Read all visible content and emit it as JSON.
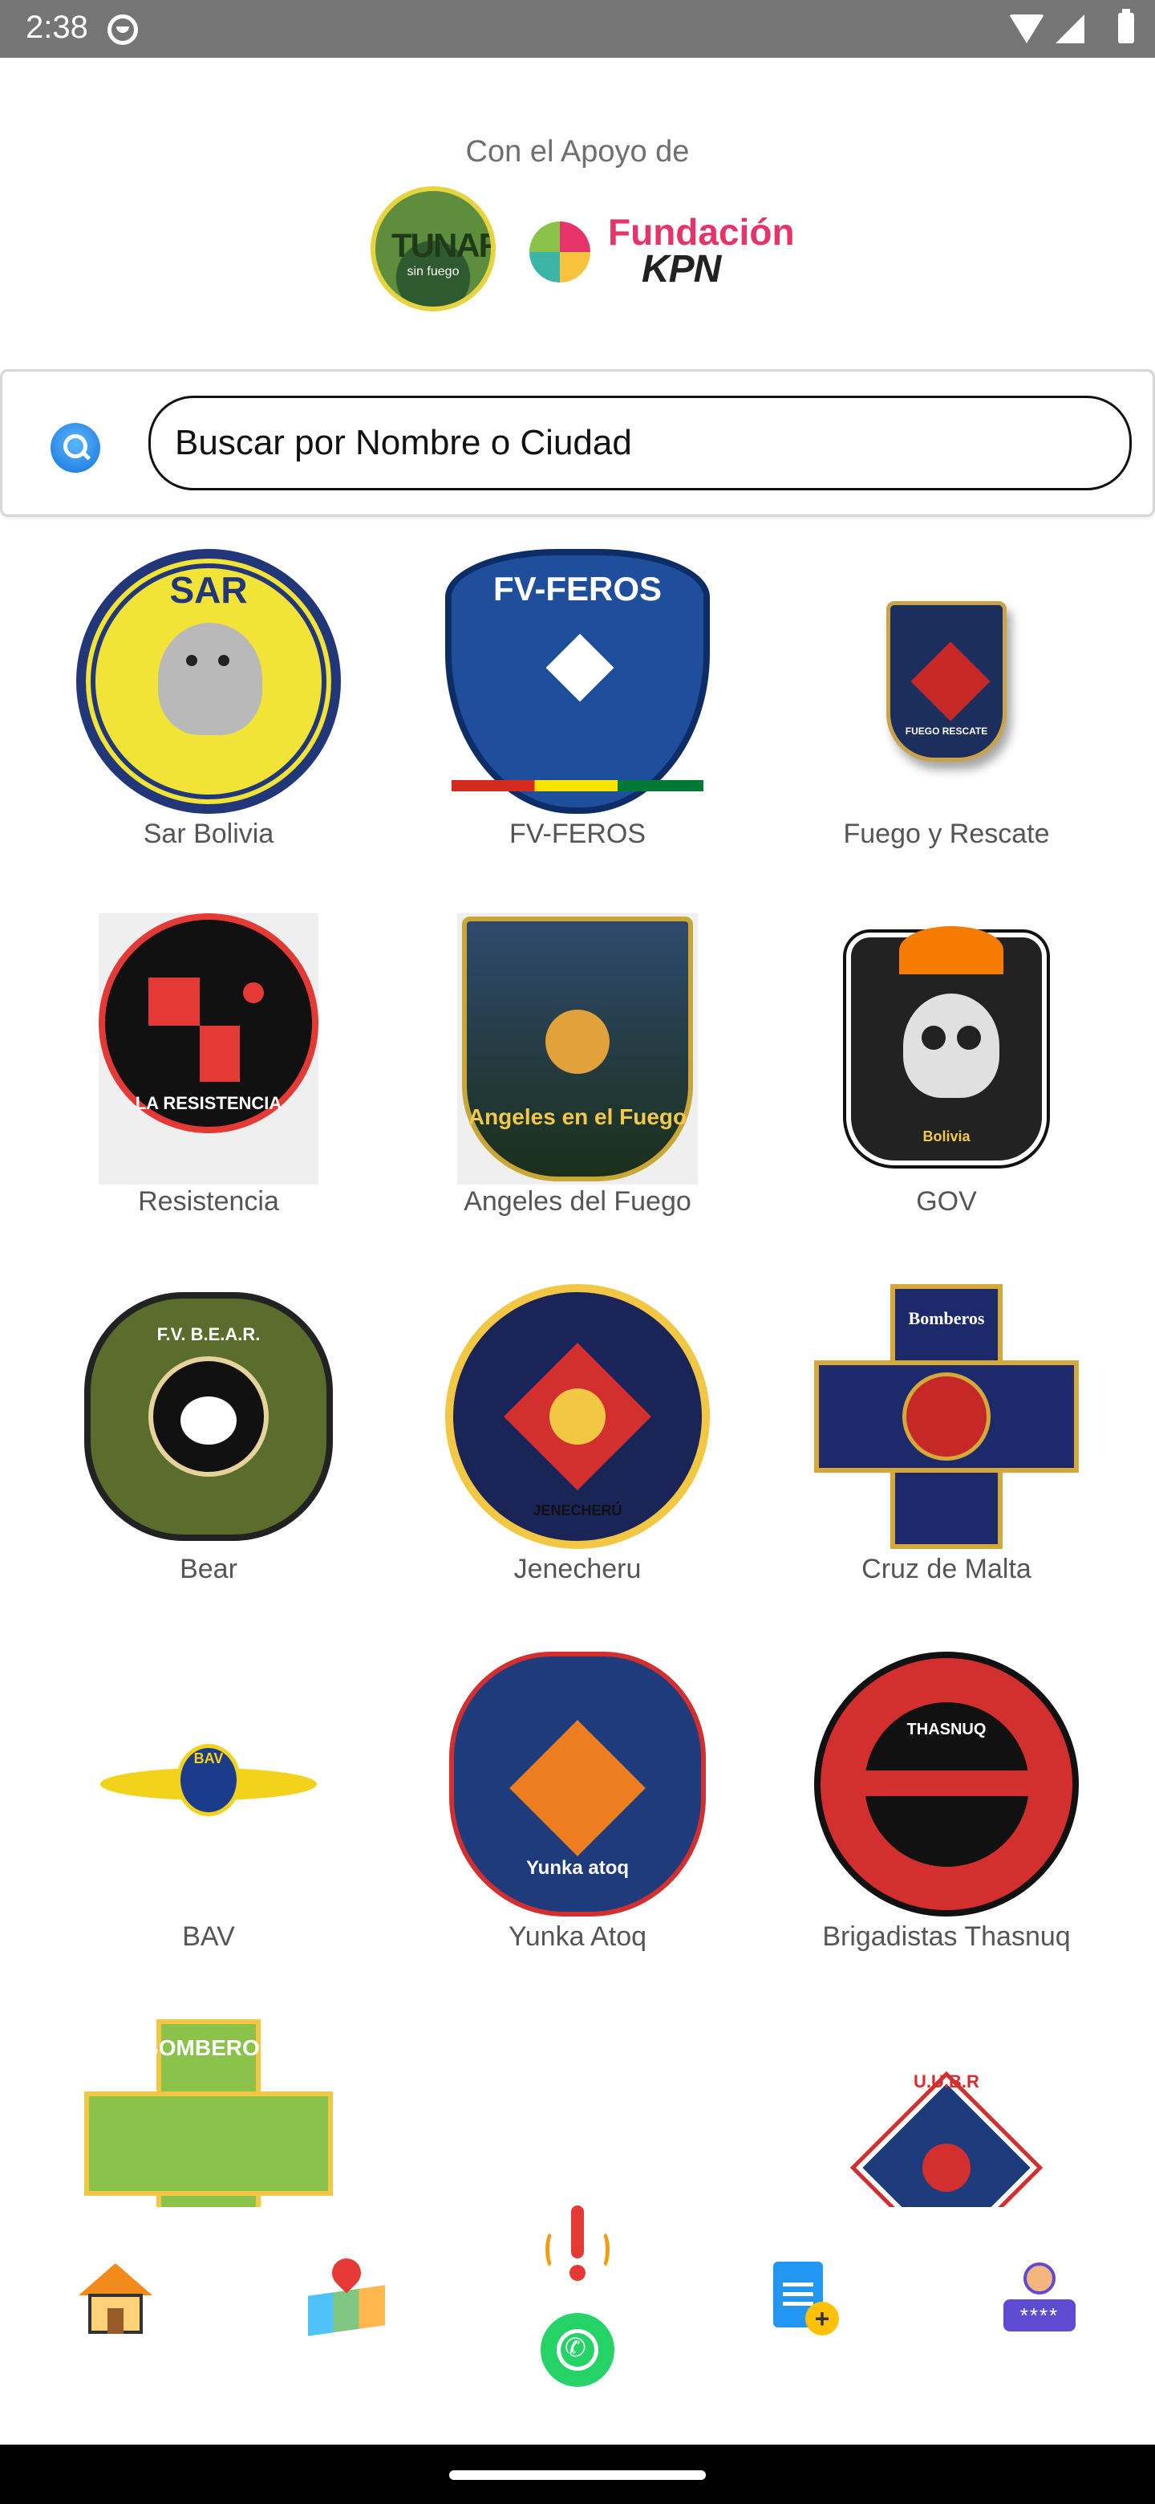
{
  "status_bar": {
    "time": "2:38"
  },
  "header": {
    "sponsor_caption": "Con el Apoyo de",
    "tunari_text": "TUNARI",
    "tunari_sub": "sin fuego",
    "kpn_line1": "Fundación",
    "kpn_line2": "KPN"
  },
  "search": {
    "placeholder": "Buscar por Nombre o Ciudad",
    "value": ""
  },
  "groups": [
    {
      "name": "Sar Bolivia",
      "badge": "SAR"
    },
    {
      "name": "FV-FEROS",
      "badge": "FV-FEROS"
    },
    {
      "name": "Fuego y Rescate",
      "badge": "FUEGO RESCATE"
    },
    {
      "name": "Resistencia",
      "badge": "LA RESISTENCIA"
    },
    {
      "name": "Angeles del Fuego",
      "badge": "Angeles en el Fuego"
    },
    {
      "name": "GOV",
      "badge": "Bolivia"
    },
    {
      "name": "Bear",
      "badge": "F.V. B.E.A.R."
    },
    {
      "name": "Jenecheru",
      "badge": "JENECHERÚ"
    },
    {
      "name": "Cruz de Malta",
      "badge": "Bomberos"
    },
    {
      "name": "BAV",
      "badge": "BAV"
    },
    {
      "name": "Yunka Atoq",
      "badge": "Yunka atoq"
    },
    {
      "name": "Brigadistas Thasnuq",
      "badge": "THASNUQ"
    },
    {
      "name": "",
      "badge": "BOMBEROS"
    },
    {
      "name": "",
      "badge": ""
    },
    {
      "name": "",
      "badge": "U.U.B.R"
    }
  ],
  "bottom_nav": {
    "items": [
      "home",
      "map",
      "alert",
      "whatsapp",
      "register",
      "profile"
    ]
  },
  "colors": {
    "status_bar": "#757575",
    "caption": "#6f6f6f",
    "label": "#555555"
  }
}
